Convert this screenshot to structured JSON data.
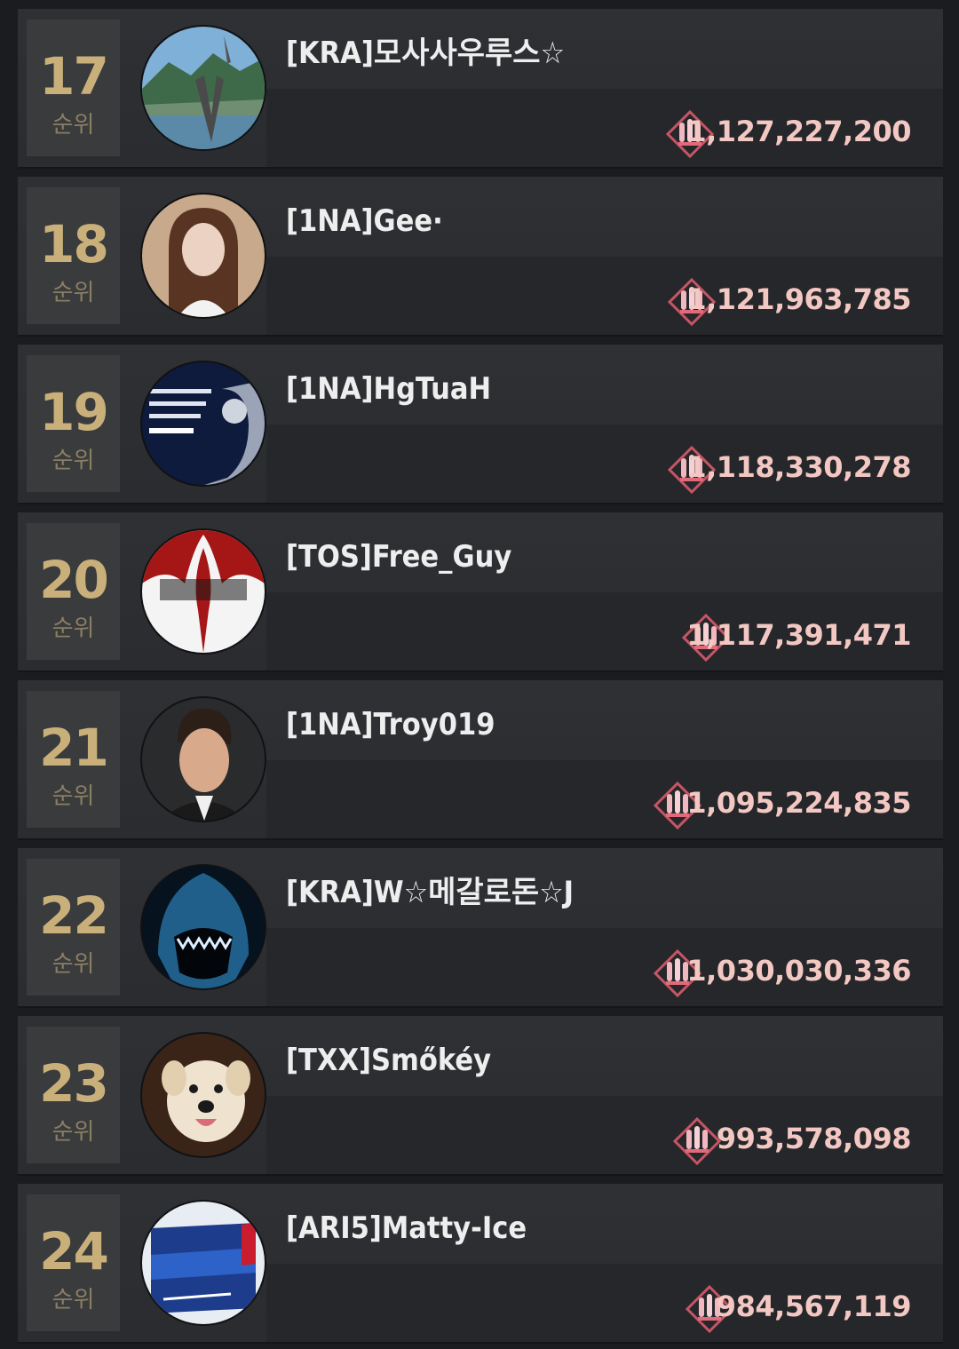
{
  "colors": {
    "background": "#1b1c1f",
    "row": "#2c2e32",
    "rank_number": "#c9b07a",
    "rank_label": "#8a7e63",
    "score": "#f3c8c3",
    "icon_accent": "#e06a7a"
  },
  "rank_label": "순위",
  "rows": [
    {
      "rank": "17",
      "name": "[KRA]모사사우루스☆",
      "score": "1,127,227,200",
      "avatar_icon": "mountain-lake-avatar-icon"
    },
    {
      "rank": "18",
      "name": "[1NA]Gee·",
      "score": "1,121,963,785",
      "avatar_icon": "woman-portrait-avatar-icon"
    },
    {
      "rank": "19",
      "name": "[1NA]HgTuaH",
      "score": "1,118,330,278",
      "avatar_icon": "quote-portrait-avatar-icon"
    },
    {
      "rank": "20",
      "name": "[TOS]Free_Guy",
      "score": "1,117,391,471",
      "avatar_icon": "fleur-de-lis-avatar-icon"
    },
    {
      "rank": "21",
      "name": "[1NA]Troy019",
      "score": "1,095,224,835",
      "avatar_icon": "man-portrait-avatar-icon"
    },
    {
      "rank": "22",
      "name": "[KRA]W☆메갈로돈☆J",
      "score": "1,030,030,336",
      "avatar_icon": "shark-avatar-icon"
    },
    {
      "rank": "23",
      "name": "[TXX]Smőkéy",
      "score": "993,578,098",
      "avatar_icon": "dog-avatar-icon"
    },
    {
      "rank": "24",
      "name": "[ARI5]Matty-Ice",
      "score": "984,567,119",
      "avatar_icon": "beer-box-avatar-icon"
    }
  ]
}
